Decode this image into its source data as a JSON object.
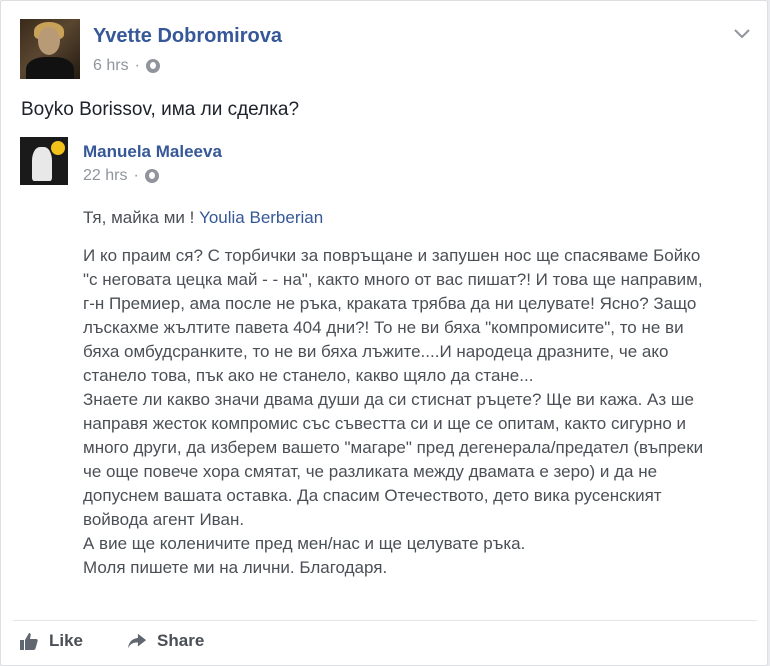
{
  "post": {
    "author": "Yvette Dobromirova",
    "time": "6 hrs",
    "separator": "·",
    "text": "Boyko Borissov, има ли сделка?",
    "chevron_icon": "chevron-down-icon",
    "privacy_icon": "globe-icon"
  },
  "shared_post": {
    "author": "Manuela Maleeva",
    "time": "22 hrs",
    "separator": "·",
    "privacy_icon": "globe-icon",
    "intro": "Тя, майка ми ! ",
    "mention": "Youlia Berberian",
    "paragraph_lines": [
      "И ко праим ся? С торбички за повръщане и запушен нос ще спасяваме Бойко",
      "\"с неговата цецка май - - на\", както много от вас пишат?! И това ще направим,",
      "г-н Премиер, ама после не ръка, краката трябва да ни целувате! Ясно? Защо",
      "лъскахме жълтите павета 404 дни?! То не ви бяха \"компромисите\", то не ви",
      "бяха омбудсранките, то не ви бяха лъжите....И народеца дразните, че ако",
      "станело това, пък ако не станело, какво щяло да стане...",
      "Знаете ли какво значи двама души да си стиснат ръцете? Ще ви кажа. Аз ше",
      "направя жесток компромис със съвестта си и ще се опитам, както сигурно и",
      "много други, да изберем вашето \"магаре\" пред дегенерала/предател (въпреки",
      "че още повече хора смятат, че разликата между двамата е зеро) и да не",
      "допуснем вашата оставка. Да спасим Отечеството, дето вика русенският",
      "войвода агент Иван.",
      "А вие ще коленичите пред мен/нас и ще целувате ръка.",
      "Моля пишете ми на лични. Благодаря."
    ]
  },
  "actions": {
    "like_label": "Like",
    "share_label": "Share",
    "like_icon": "thumbs-up-icon",
    "share_icon": "share-arrow-icon"
  },
  "colors": {
    "link": "#365899",
    "meta": "#90949c",
    "text": "#1d2129",
    "body_text": "#4b4f56"
  }
}
